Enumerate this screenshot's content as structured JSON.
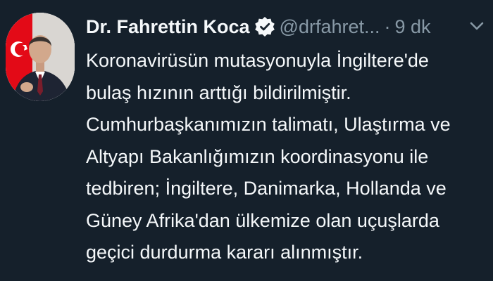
{
  "tweet": {
    "author": {
      "display_name": "Dr. Fahrettin Koca",
      "handle": "@drfahret...",
      "verified": true,
      "avatar_icon": "profile-photo-with-flag"
    },
    "separator": "·",
    "timestamp": "9 dk",
    "menu_icon": "chevron-down-icon",
    "body_lines": [
      "Koronavirüsün mutasyonuyla İngiltere'de",
      "bulaş hızının arttığı bildirilmiştir.",
      "Cumhurbaşkanımızın talimatı, Ulaştırma ve",
      "Altyapı Bakanlığımızın koordinasyonu ile",
      "tedbiren; İngiltere, Danimarka, Hollanda ve",
      "Güney Afrika'dan ülkemize olan uçuşlarda",
      "geçici durdurma kararı alınmıştır."
    ]
  },
  "colors": {
    "background": "#15202b",
    "primary_text": "#f5f8fa",
    "secondary_text": "#8899a6",
    "flag_red": "#e30a17"
  }
}
